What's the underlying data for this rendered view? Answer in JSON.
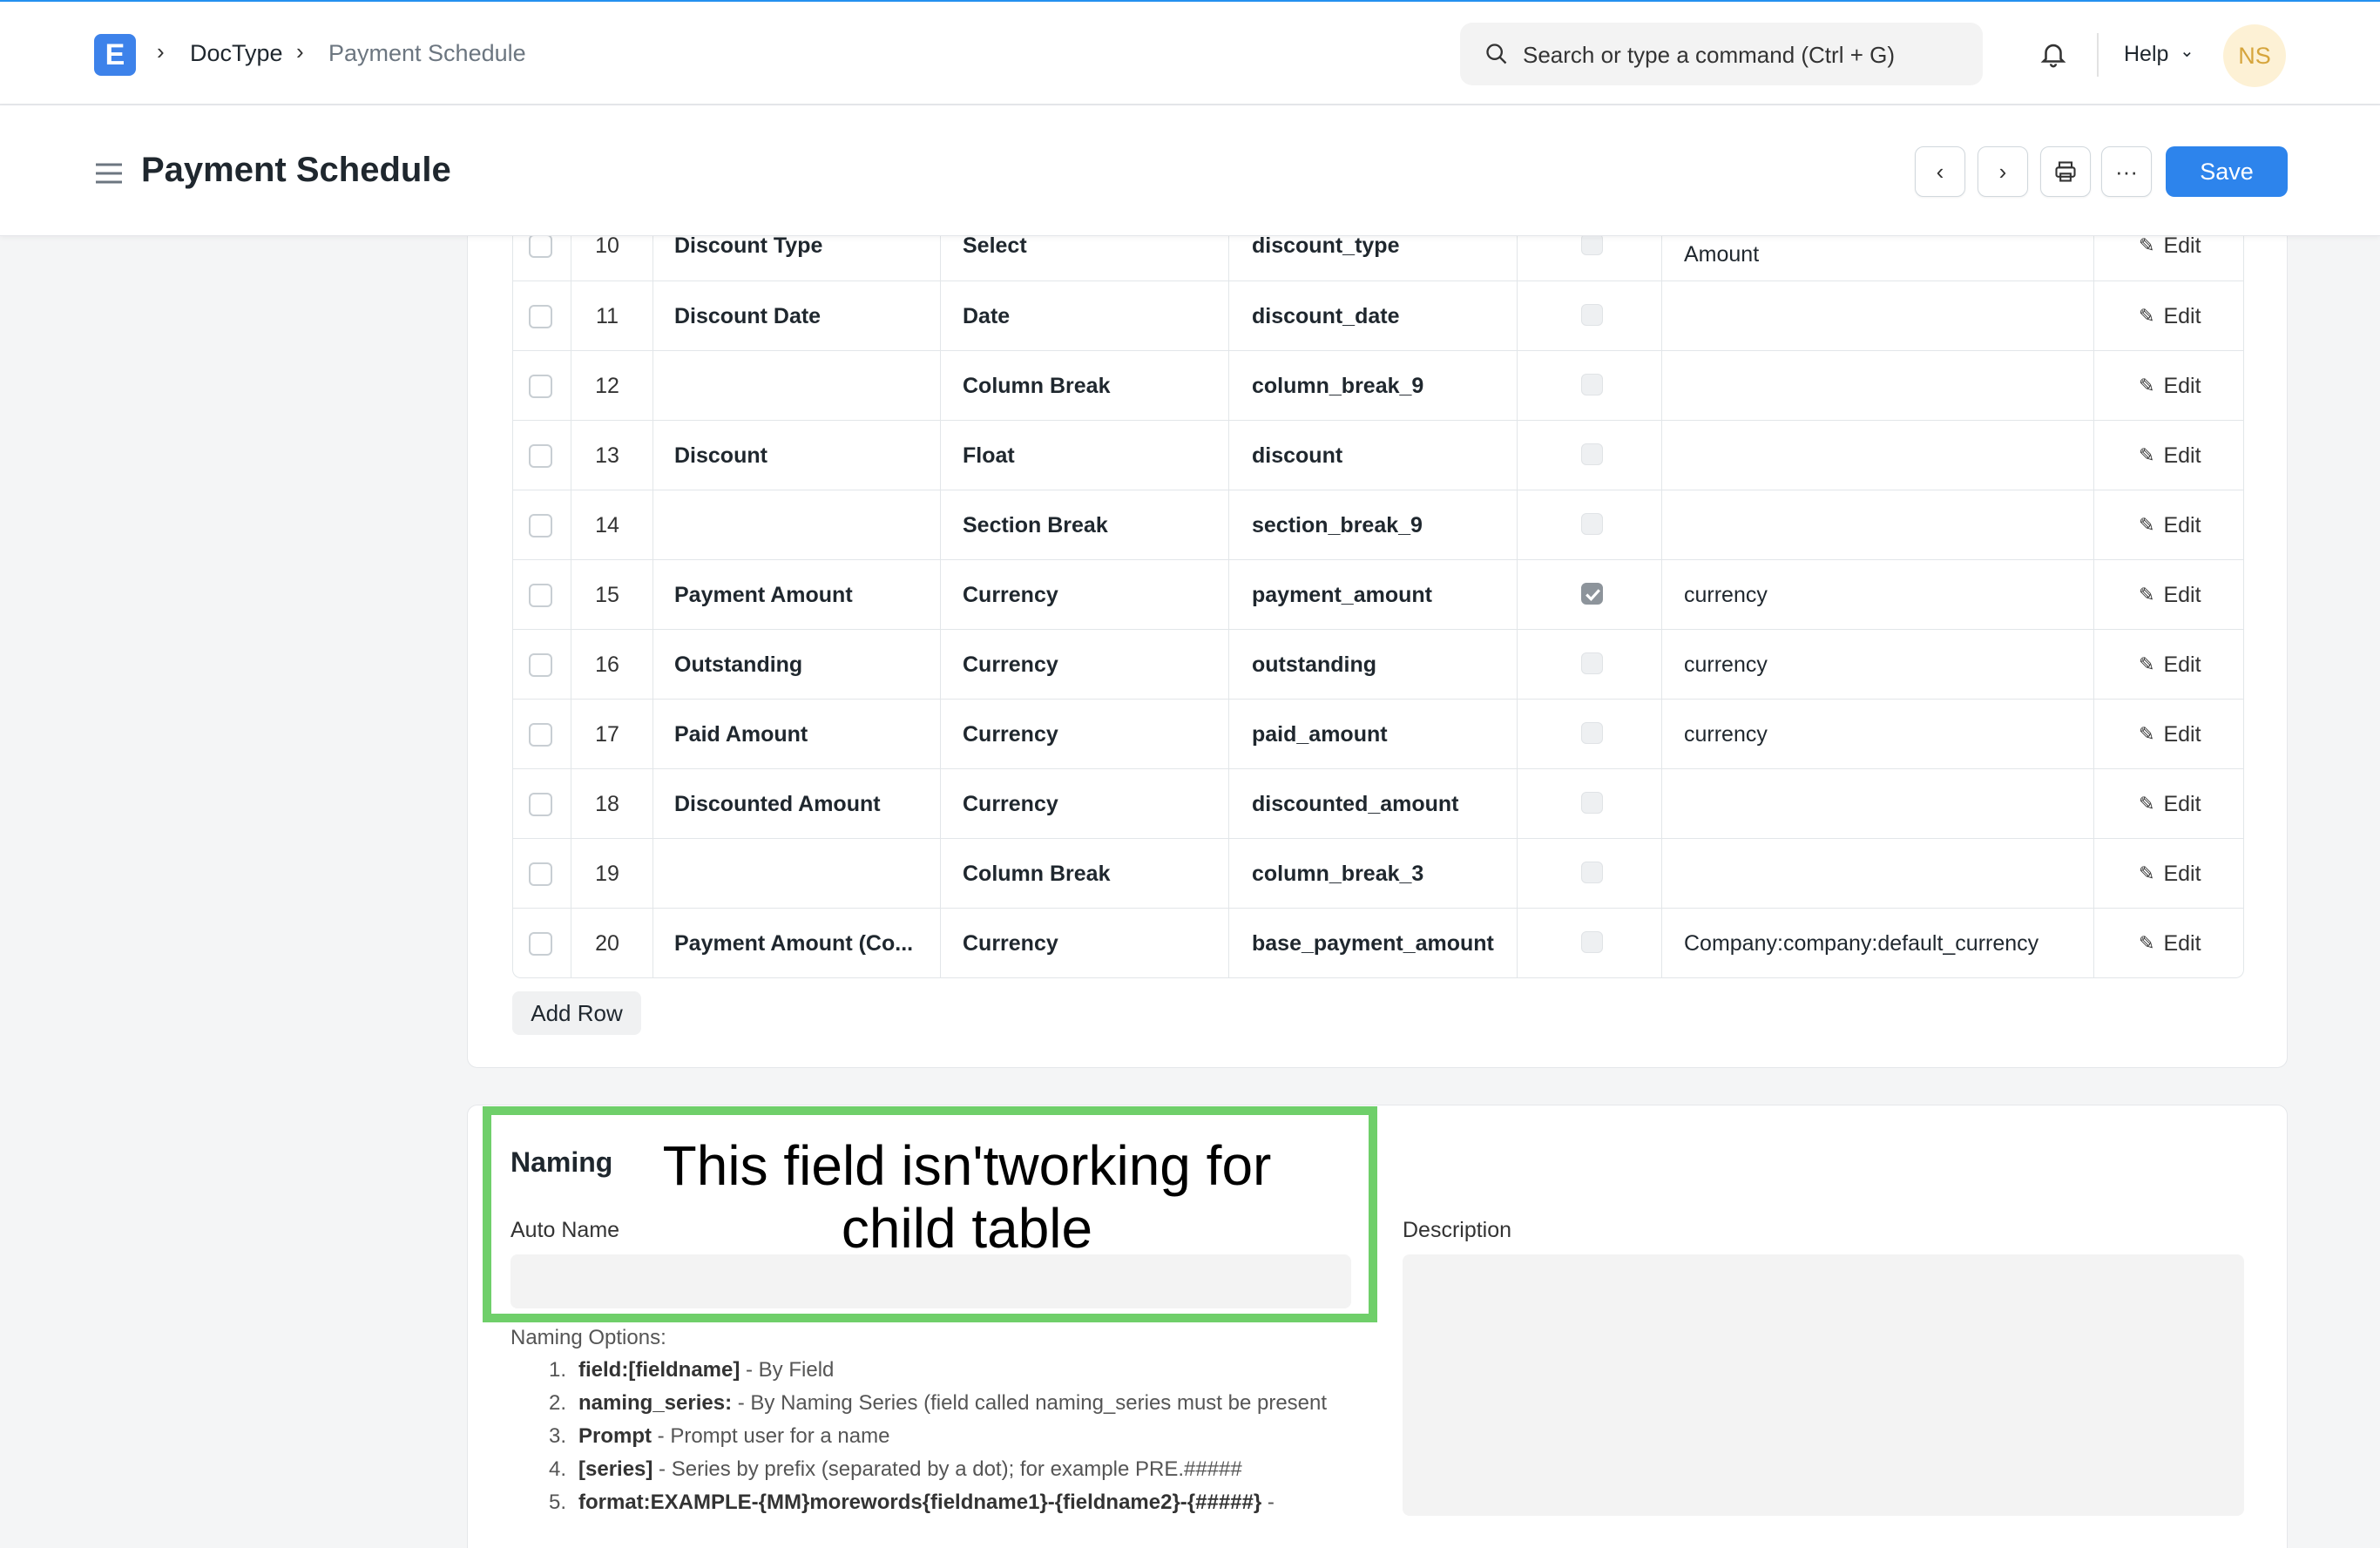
{
  "navbar": {
    "breadcrumbs": [
      "DocType",
      "Payment Schedule"
    ],
    "search_placeholder": "Search or type a command (Ctrl + G)",
    "help_label": "Help",
    "avatar_initials": "NS"
  },
  "header": {
    "title": "Payment Schedule",
    "save_label": "Save"
  },
  "fields_table": {
    "rows": [
      {
        "no": "10",
        "label": "Discount Type",
        "type": "Select",
        "name": "discount_type",
        "mandatory": false,
        "options": "Percentage\nAmount",
        "edit": "Edit"
      },
      {
        "no": "11",
        "label": "Discount Date",
        "type": "Date",
        "name": "discount_date",
        "mandatory": false,
        "options": "",
        "edit": "Edit"
      },
      {
        "no": "12",
        "label": "",
        "type": "Column Break",
        "name": "column_break_9",
        "mandatory": false,
        "options": "",
        "edit": "Edit"
      },
      {
        "no": "13",
        "label": "Discount",
        "type": "Float",
        "name": "discount",
        "mandatory": false,
        "options": "",
        "edit": "Edit"
      },
      {
        "no": "14",
        "label": "",
        "type": "Section Break",
        "name": "section_break_9",
        "mandatory": false,
        "options": "",
        "edit": "Edit"
      },
      {
        "no": "15",
        "label": "Payment Amount",
        "type": "Currency",
        "name": "payment_amount",
        "mandatory": true,
        "options": "currency",
        "edit": "Edit"
      },
      {
        "no": "16",
        "label": "Outstanding",
        "type": "Currency",
        "name": "outstanding",
        "mandatory": false,
        "options": "currency",
        "edit": "Edit"
      },
      {
        "no": "17",
        "label": "Paid Amount",
        "type": "Currency",
        "name": "paid_amount",
        "mandatory": false,
        "options": "currency",
        "edit": "Edit"
      },
      {
        "no": "18",
        "label": "Discounted Amount",
        "type": "Currency",
        "name": "discounted_amount",
        "mandatory": false,
        "options": "",
        "edit": "Edit"
      },
      {
        "no": "19",
        "label": "",
        "type": "Column Break",
        "name": "column_break_3",
        "mandatory": false,
        "options": "",
        "edit": "Edit"
      },
      {
        "no": "20",
        "label": "Payment Amount (Co...",
        "type": "Currency",
        "name": "base_payment_amount",
        "mandatory": false,
        "options": "Company:company:default_currency",
        "edit": "Edit"
      }
    ],
    "add_row_label": "Add Row"
  },
  "naming": {
    "section_title": "Naming",
    "annotation": "This field isn'tworking for child table",
    "auto_name_label": "Auto Name",
    "auto_name_value": "",
    "description_label": "Description",
    "description_value": "",
    "options_title": "Naming Options:",
    "options": [
      {
        "n": "1.",
        "key": "field:[fieldname]",
        "text": " - By Field"
      },
      {
        "n": "2.",
        "key": "naming_series:",
        "text": " - By Naming Series (field called naming_series must be present"
      },
      {
        "n": "3.",
        "key": "Prompt",
        "text": " - Prompt user for a name"
      },
      {
        "n": "4.",
        "key": "[series]",
        "text": " - Series by prefix (separated by a dot); for example PRE.#####"
      },
      {
        "n": "5.",
        "key": "format:EXAMPLE-{MM}morewords{fieldname1}-{fieldname2}-{#####}",
        "text": " -"
      }
    ]
  },
  "colors": {
    "accent": "#2d84ec",
    "highlight": "#6fcf6a",
    "logo": "#3d82ea"
  }
}
